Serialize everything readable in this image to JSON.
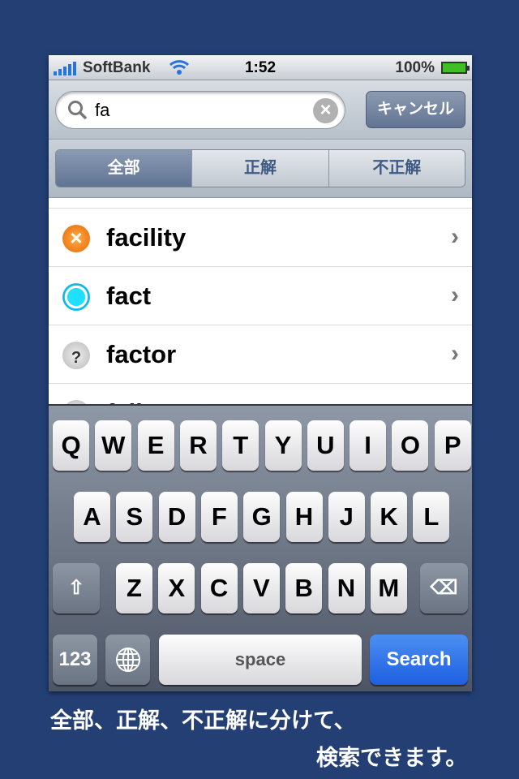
{
  "status": {
    "carrier": "SoftBank",
    "time": "1:52",
    "battery": "100%"
  },
  "search": {
    "query": "fa",
    "cancel_label": "キャンセル"
  },
  "segments": [
    {
      "label": "全部",
      "selected": true
    },
    {
      "label": "正解",
      "selected": false
    },
    {
      "label": "不正解",
      "selected": false
    }
  ],
  "results": [
    {
      "word": "facility",
      "status_icon": "incorrect-x-icon"
    },
    {
      "word": "fact",
      "status_icon": "correct-circle-icon"
    },
    {
      "word": "factor",
      "status_icon": "unknown-question-icon"
    },
    {
      "word": "fail",
      "status_icon": "unknown-question-icon"
    }
  ],
  "keyboard": {
    "row1": [
      "Q",
      "W",
      "E",
      "R",
      "T",
      "Y",
      "U",
      "I",
      "O",
      "P"
    ],
    "row2": [
      "A",
      "S",
      "D",
      "F",
      "G",
      "H",
      "J",
      "K",
      "L"
    ],
    "row3": [
      "Z",
      "X",
      "C",
      "V",
      "B",
      "N",
      "M"
    ],
    "numbers_label": "123",
    "space_label": "space",
    "search_label": "Search"
  },
  "caption": {
    "line1": "全部、正解、不正解に分けて、",
    "line2": "検索できます。"
  },
  "colors": {
    "background": "#233f74",
    "search_key": "#2a6ae6",
    "segment_selected": "#6d7f9c"
  }
}
